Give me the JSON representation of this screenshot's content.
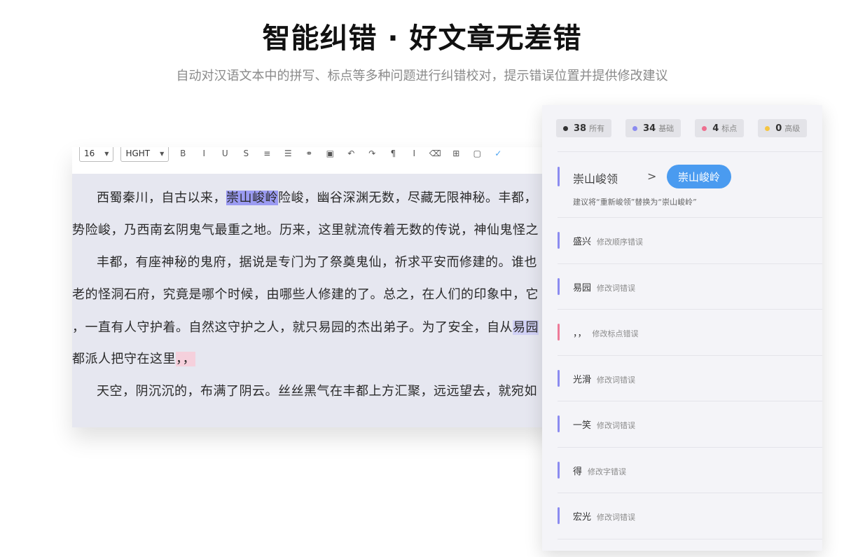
{
  "hero": {
    "title": "智能纠错 · 好文章无差错",
    "subtitle": "自动对汉语文本中的拼写、标点等多种问题进行纠错校对，提示错误位置并提供修改建议"
  },
  "editor": {
    "toolbar": {
      "font_size": "16",
      "font_family": "HGHT",
      "icons": [
        "bold-icon",
        "italic-icon",
        "underline-icon",
        "strikethrough-icon",
        "align-icon",
        "list-icon",
        "link-icon",
        "image-icon",
        "undo-icon",
        "redo-icon",
        "format-icon",
        "cursor-icon",
        "clear-icon",
        "table-icon",
        "screen-icon",
        "check-icon"
      ]
    },
    "lines": [
      {
        "pre": "西蜀秦川，自古以来，",
        "hl": "崇山峻岭",
        "hl_type": "purple",
        "post": "险峻，幽谷深渊无数，尽藏无限神秘。丰都，"
      },
      {
        "pre": "势险峻，乃西南玄阴鬼气最重之地。历来，这里就流传着无数的传说，神仙鬼怪之",
        "hl": "",
        "hl_type": "",
        "post": ""
      },
      {
        "pre": "丰都，有座神秘的鬼府，据说是专门为了祭奠鬼仙，祈求平安而修建的。谁也",
        "hl": "",
        "hl_type": "",
        "post": ""
      },
      {
        "pre": "老的怪洞石府，究竟是哪个时候，由哪些人修建的了。总之，在人们的印象中，它",
        "hl": "",
        "hl_type": "",
        "post": ""
      },
      {
        "pre": "，一直有人守护着。自然这守护之人，就只易园的杰出弟子。为了安全，自从",
        "hl": "易园",
        "hl_type": "light",
        "post": ""
      },
      {
        "pre": "都派人把守在这里",
        "hl": "，，",
        "hl_type": "pink",
        "post": ""
      },
      {
        "pre": "天空，阴沉沉的，布满了阴云。丝丝黑气在丰都上方汇聚，远远望去，就宛如",
        "hl": "",
        "hl_type": "",
        "post": ""
      }
    ]
  },
  "panel": {
    "stats": [
      {
        "count": "38",
        "label": "所有",
        "color": "#333333"
      },
      {
        "count": "34",
        "label": "基础",
        "color": "#8b8bf0"
      },
      {
        "count": "4",
        "label": "标点",
        "color": "#ee6f8f"
      },
      {
        "count": "0",
        "label": "高级",
        "color": "#f5c542"
      }
    ],
    "top_suggestion": {
      "original": "崇山峻领",
      "arrow": ">",
      "replacement": "崇山峻岭",
      "advice": "建议将“重新峻领”替换为“崇山峻岭”"
    },
    "suggestions": [
      {
        "word": "盛兴",
        "desc": "修改顺序错误",
        "type": "basic"
      },
      {
        "word": "易园",
        "desc": "修改词错误",
        "type": "basic"
      },
      {
        "word": "，，",
        "desc": "修改标点错误",
        "type": "punct"
      },
      {
        "word": "光滑",
        "desc": "修改词错误",
        "type": "basic"
      },
      {
        "word": "一笑",
        "desc": "修改词错误",
        "type": "basic"
      },
      {
        "word": "得",
        "desc": "修改字错误",
        "type": "basic"
      },
      {
        "word": "宏光",
        "desc": "修改词错误",
        "type": "basic"
      }
    ]
  }
}
